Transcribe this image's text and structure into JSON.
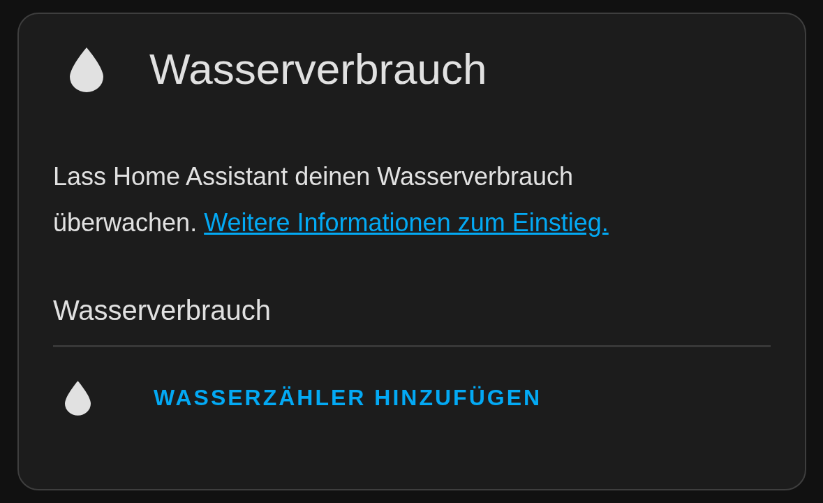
{
  "card": {
    "title": "Wasserverbrauch",
    "description": {
      "text": "Lass Home Assistant deinen Wasserverbrauch überwachen.",
      "link": "Weitere Informationen zum Einstieg."
    },
    "section": {
      "heading": "Wasserverbrauch",
      "action": {
        "label": "WASSERZÄHLER HINZUFÜGEN"
      }
    }
  }
}
